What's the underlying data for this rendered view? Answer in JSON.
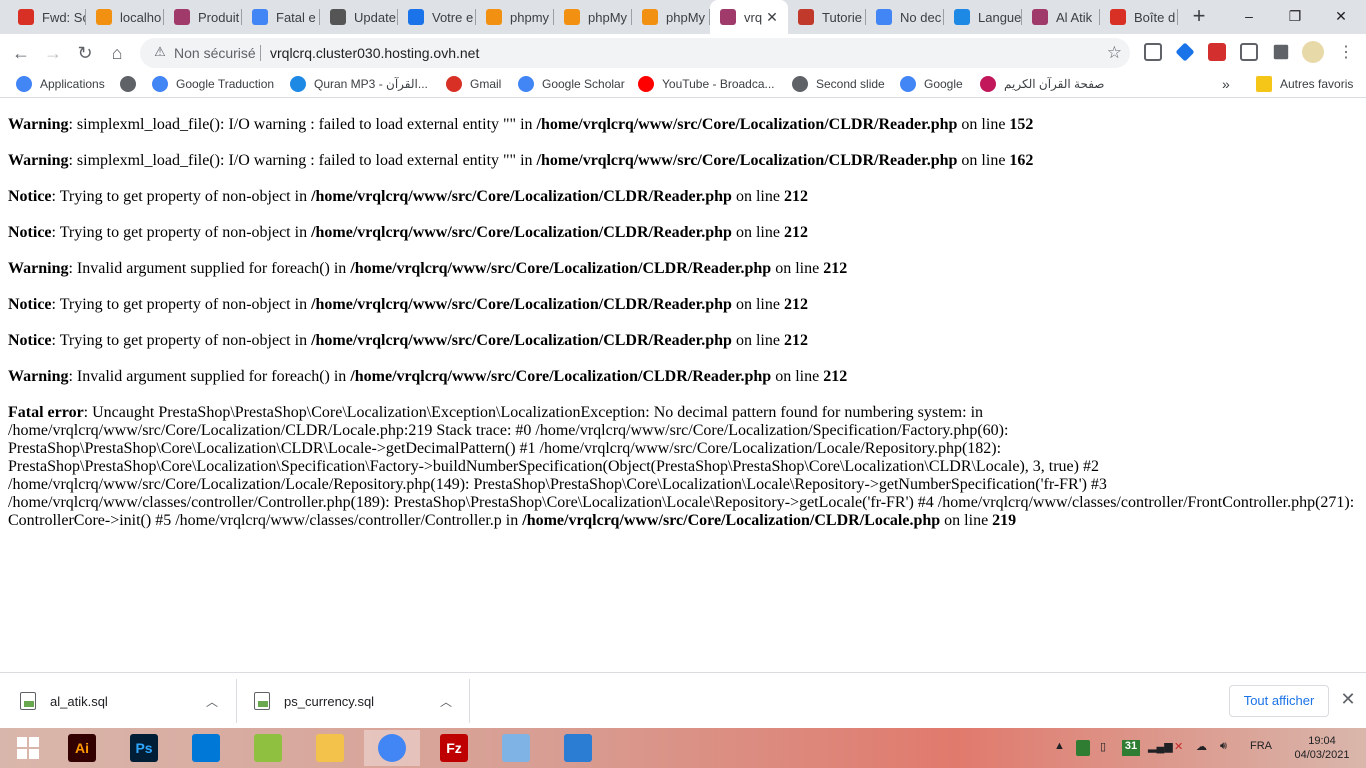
{
  "browser": {
    "tabs": [
      {
        "title": "Fwd: Sc",
        "icon": "gmail-icon",
        "color": "#d93025"
      },
      {
        "title": "localho",
        "icon": "phpmyadmin-icon",
        "color": "#f29111"
      },
      {
        "title": "Produit",
        "icon": "prestashop-icon",
        "color": "#a03a6a"
      },
      {
        "title": "Fatal e",
        "icon": "google-icon",
        "color": "#4285f4"
      },
      {
        "title": "Update",
        "icon": "update-icon",
        "color": "#555555"
      },
      {
        "title": "Votre e",
        "icon": "site-icon",
        "color": "#1a73e8"
      },
      {
        "title": "phpmy",
        "icon": "phpmyadmin-icon",
        "color": "#f29111"
      },
      {
        "title": "phpMy",
        "icon": "phpmyadmin-icon",
        "color": "#f29111"
      },
      {
        "title": "phpMy",
        "icon": "phpmyadmin-icon",
        "color": "#f29111"
      },
      {
        "title": "vrq",
        "icon": "prestashop-icon",
        "color": "#a03a6a",
        "active": true
      },
      {
        "title": "Tutorie",
        "icon": "tutorial-icon",
        "color": "#c0392b"
      },
      {
        "title": "No dec",
        "icon": "google-icon",
        "color": "#4285f4"
      },
      {
        "title": "Langue",
        "icon": "translate-icon",
        "color": "#1e88e5"
      },
      {
        "title": "Al Atik",
        "icon": "prestashop-icon",
        "color": "#a03a6a"
      },
      {
        "title": "Boîte d",
        "icon": "gmail-icon",
        "color": "#d93025"
      }
    ],
    "close_tab_glyph": "✕",
    "new_tab_glyph": "+",
    "url_security": "Non sécurisé",
    "url": "vrqlcrq.cluster030.hosting.ovh.net"
  },
  "bookmarks": [
    {
      "label": "Applications",
      "icon": "apps-icon",
      "color": "#4285f4"
    },
    {
      "label": "",
      "icon": "globe-icon",
      "color": "#5f6368"
    },
    {
      "label": "Google Traduction",
      "icon": "translate-icon",
      "color": "#4285f4"
    },
    {
      "label": "Quran MP3 - القرآن...",
      "icon": "quran-icon",
      "color": "#1e88e5"
    },
    {
      "label": "Gmail",
      "icon": "gmail-icon",
      "color": "#d93025"
    },
    {
      "label": "Google Scholar",
      "icon": "scholar-icon",
      "color": "#4285f4"
    },
    {
      "label": "YouTube - Broadca...",
      "icon": "youtube-icon",
      "color": "#ff0000"
    },
    {
      "label": "Second slide",
      "icon": "globe-icon",
      "color": "#5f6368"
    },
    {
      "label": "Google",
      "icon": "google-icon",
      "color": "#4285f4"
    },
    {
      "label": "صفحة القرآن الكريم",
      "icon": "quran-page-icon",
      "color": "#c2185b"
    }
  ],
  "bookmarks_other": "Autres favoris",
  "bookmarks_more": "»",
  "messages": [
    {
      "level": "Warning",
      "text": ": simplexml_load_file(): I/O warning : failed to load external entity \"\" in ",
      "file": "/home/vrqlcrq/www/src/Core/Localization/CLDR/Reader.php",
      "on_line": " on line ",
      "line": "152"
    },
    {
      "level": "Warning",
      "text": ": simplexml_load_file(): I/O warning : failed to load external entity \"\" in ",
      "file": "/home/vrqlcrq/www/src/Core/Localization/CLDR/Reader.php",
      "on_line": " on line ",
      "line": "162"
    },
    {
      "level": "Notice",
      "text": ": Trying to get property of non-object in ",
      "file": "/home/vrqlcrq/www/src/Core/Localization/CLDR/Reader.php",
      "on_line": " on line ",
      "line": "212"
    },
    {
      "level": "Notice",
      "text": ": Trying to get property of non-object in ",
      "file": "/home/vrqlcrq/www/src/Core/Localization/CLDR/Reader.php",
      "on_line": " on line ",
      "line": "212"
    },
    {
      "level": "Warning",
      "text": ": Invalid argument supplied for foreach() in ",
      "file": "/home/vrqlcrq/www/src/Core/Localization/CLDR/Reader.php",
      "on_line": " on line ",
      "line": "212"
    },
    {
      "level": "Notice",
      "text": ": Trying to get property of non-object in ",
      "file": "/home/vrqlcrq/www/src/Core/Localization/CLDR/Reader.php",
      "on_line": " on line ",
      "line": "212"
    },
    {
      "level": "Notice",
      "text": ": Trying to get property of non-object in ",
      "file": "/home/vrqlcrq/www/src/Core/Localization/CLDR/Reader.php",
      "on_line": " on line ",
      "line": "212"
    },
    {
      "level": "Warning",
      "text": ": Invalid argument supplied for foreach() in ",
      "file": "/home/vrqlcrq/www/src/Core/Localization/CLDR/Reader.php",
      "on_line": " on line ",
      "line": "212"
    }
  ],
  "fatal": {
    "level": "Fatal error",
    "text": ": Uncaught PrestaShop\\PrestaShop\\Core\\Localization\\Exception\\LocalizationException: No decimal pattern found for numbering system: in /home/vrqlcrq/www/src/Core/Localization/CLDR/Locale.php:219 Stack trace: #0 /home/vrqlcrq/www/src/Core/Localization/Specification/Factory.php(60): PrestaShop\\PrestaShop\\Core\\Localization\\CLDR\\Locale->getDecimalPattern() #1 /home/vrqlcrq/www/src/Core/Localization/Locale/Repository.php(182): PrestaShop\\PrestaShop\\Core\\Localization\\Specification\\Factory->buildNumberSpecification(Object(PrestaShop\\PrestaShop\\Core\\Localization\\CLDR\\Locale), 3, true) #2 /home/vrqlcrq/www/src/Core/Localization/Locale/Repository.php(149): PrestaShop\\PrestaShop\\Core\\Localization\\Locale\\Repository->getNumberSpecification('fr-FR') #3 /home/vrqlcrq/www/classes/controller/Controller.php(189): PrestaShop\\PrestaShop\\Core\\Localization\\Locale\\Repository->getLocale('fr-FR') #4 /home/vrqlcrq/www/classes/controller/FrontController.php(271): ControllerCore->init() #5 /home/vrqlcrq/www/classes/controller/Controller.p in ",
    "file": "/home/vrqlcrq/www/src/Core/Localization/CLDR/Locale.php",
    "on_line": " on line ",
    "line": "219"
  },
  "downloads": {
    "items": [
      {
        "name": "al_atik.sql"
      },
      {
        "name": "ps_currency.sql"
      }
    ],
    "show_all": "Tout afficher"
  },
  "taskbar": {
    "apps": [
      {
        "name": "windows-start-icon",
        "label": "",
        "color": "transparent"
      },
      {
        "name": "illustrator-icon",
        "label": "Ai",
        "color": "#330000",
        "fg": "#ff9a00"
      },
      {
        "name": "photoshop-icon",
        "label": "Ps",
        "color": "#001e36",
        "fg": "#31a8ff"
      },
      {
        "name": "vscode-icon",
        "label": "",
        "color": "#0078d7"
      },
      {
        "name": "notepadpp-icon",
        "label": "",
        "color": "#90c040"
      },
      {
        "name": "file-explorer-icon",
        "label": "",
        "color": "#f3c24b"
      },
      {
        "name": "chrome-icon",
        "label": "",
        "color": "#4285f4"
      },
      {
        "name": "filezilla-icon",
        "label": "Fz",
        "color": "#bf0000",
        "fg": "#fff"
      },
      {
        "name": "paint-icon",
        "label": "",
        "color": "#7fb2e5"
      },
      {
        "name": "photos-icon",
        "label": "",
        "color": "#2b7cd3"
      }
    ],
    "calendar_badge": "31",
    "language": "FRA",
    "time": "19:04",
    "date": "04/03/2021"
  }
}
